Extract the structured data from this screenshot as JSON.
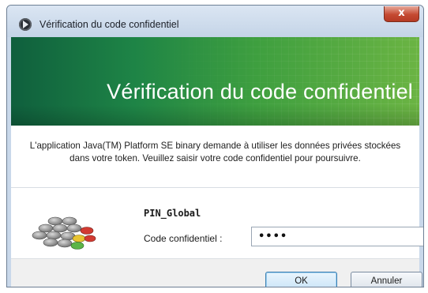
{
  "window": {
    "title": "Vérification du code confidentiel",
    "close_label": "x"
  },
  "banner": {
    "title": "Vérification du code confidentiel"
  },
  "message": "L'application Java(TM) Platform SE binary demande à utiliser les données privées stockées dans votre token. Veuillez saisir votre code confidentiel pour poursuivre.",
  "pin": {
    "name": "PIN_Global",
    "label": "Code confidentiel :",
    "value": "••••"
  },
  "buttons": {
    "ok": "OK",
    "cancel": "Annuler"
  },
  "icons": {
    "app": "java-app-icon",
    "token": "token-stack-icon"
  }
}
